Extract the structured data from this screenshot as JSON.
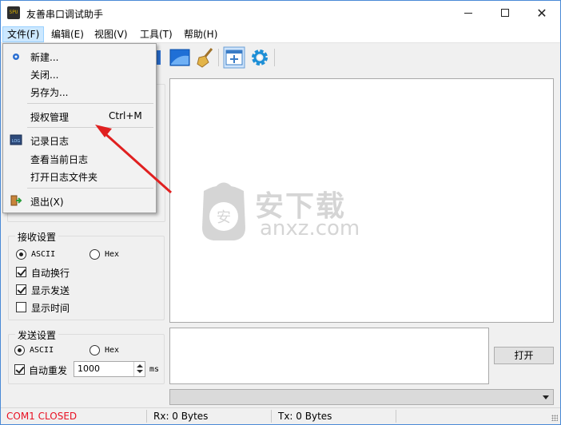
{
  "window": {
    "title": "友善串口调试助手",
    "app_icon_text": "SPU"
  },
  "menubar": {
    "items": [
      "文件(F)",
      "编辑(E)",
      "视图(V)",
      "工具(T)",
      "帮助(H)"
    ],
    "active_index": 0
  },
  "toolbar": {
    "icons": [
      "save-icon",
      "window-icon",
      "broom-icon",
      "add-panel-icon",
      "gear-icon"
    ]
  },
  "file_menu": {
    "items": [
      {
        "label": "新建...",
        "icon": "new-icon"
      },
      {
        "label": "关闭..."
      },
      {
        "label": "另存为..."
      },
      {
        "label": "授权管理",
        "shortcut": "Ctrl+M"
      },
      {
        "label": "记录日志",
        "icon": "log-icon"
      },
      {
        "label": "查看当前日志"
      },
      {
        "label": "打开日志文件夹"
      },
      {
        "label": "退出(X)",
        "icon": "exit-icon"
      }
    ]
  },
  "receive_settings": {
    "title": "接收设置",
    "ascii_label": "ASCII",
    "hex_label": "Hex",
    "ascii_selected": true,
    "auto_newline": {
      "label": "自动换行",
      "checked": true
    },
    "show_send": {
      "label": "显示发送",
      "checked": true
    },
    "show_time": {
      "label": "显示时间",
      "checked": false
    }
  },
  "send_settings": {
    "title": "发送设置",
    "ascii_label": "ASCII",
    "hex_label": "Hex",
    "ascii_selected": true,
    "auto_resend": {
      "label": "自动重发",
      "checked": true
    },
    "interval_value": "1000",
    "interval_unit": "ms"
  },
  "main": {
    "open_button": "打开",
    "watermark_cn": "安下载",
    "watermark_en": "anxz.com"
  },
  "statusbar": {
    "com_status": "COM1 CLOSED",
    "rx": "Rx: 0 Bytes",
    "tx": "Tx: 0 Bytes"
  },
  "colors": {
    "accent": "#4a8ad6",
    "menu_highlight": "#cce8ff",
    "status_error": "#e81123",
    "arrow": "#e02020"
  }
}
